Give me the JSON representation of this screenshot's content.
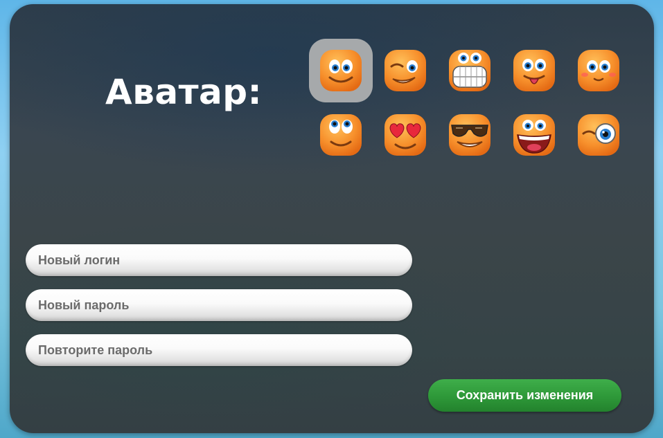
{
  "profile": {
    "avatar_label": "Аватар:",
    "avatars": [
      {
        "icon": "smiley-happy-icon",
        "selected": true
      },
      {
        "icon": "smiley-wink-icon",
        "selected": false
      },
      {
        "icon": "smiley-grin-teeth-icon",
        "selected": false
      },
      {
        "icon": "smiley-tongue-icon",
        "selected": false
      },
      {
        "icon": "smiley-blush-icon",
        "selected": false
      },
      {
        "icon": "smiley-look-up-icon",
        "selected": false
      },
      {
        "icon": "smiley-heart-eyes-icon",
        "selected": false
      },
      {
        "icon": "smiley-sunglasses-icon",
        "selected": false
      },
      {
        "icon": "smiley-laugh-icon",
        "selected": false
      },
      {
        "icon": "smiley-monocle-icon",
        "selected": false
      }
    ],
    "login_placeholder": "Новый логин",
    "password_placeholder": "Новый пароль",
    "repeat_password_placeholder": "Повторите пароль",
    "save_label": "Сохранить изменения"
  },
  "colors": {
    "accent_green": "#2f9a3a",
    "smiley_orange": "#f4892a",
    "selected_highlight": "#a6a9ab"
  }
}
